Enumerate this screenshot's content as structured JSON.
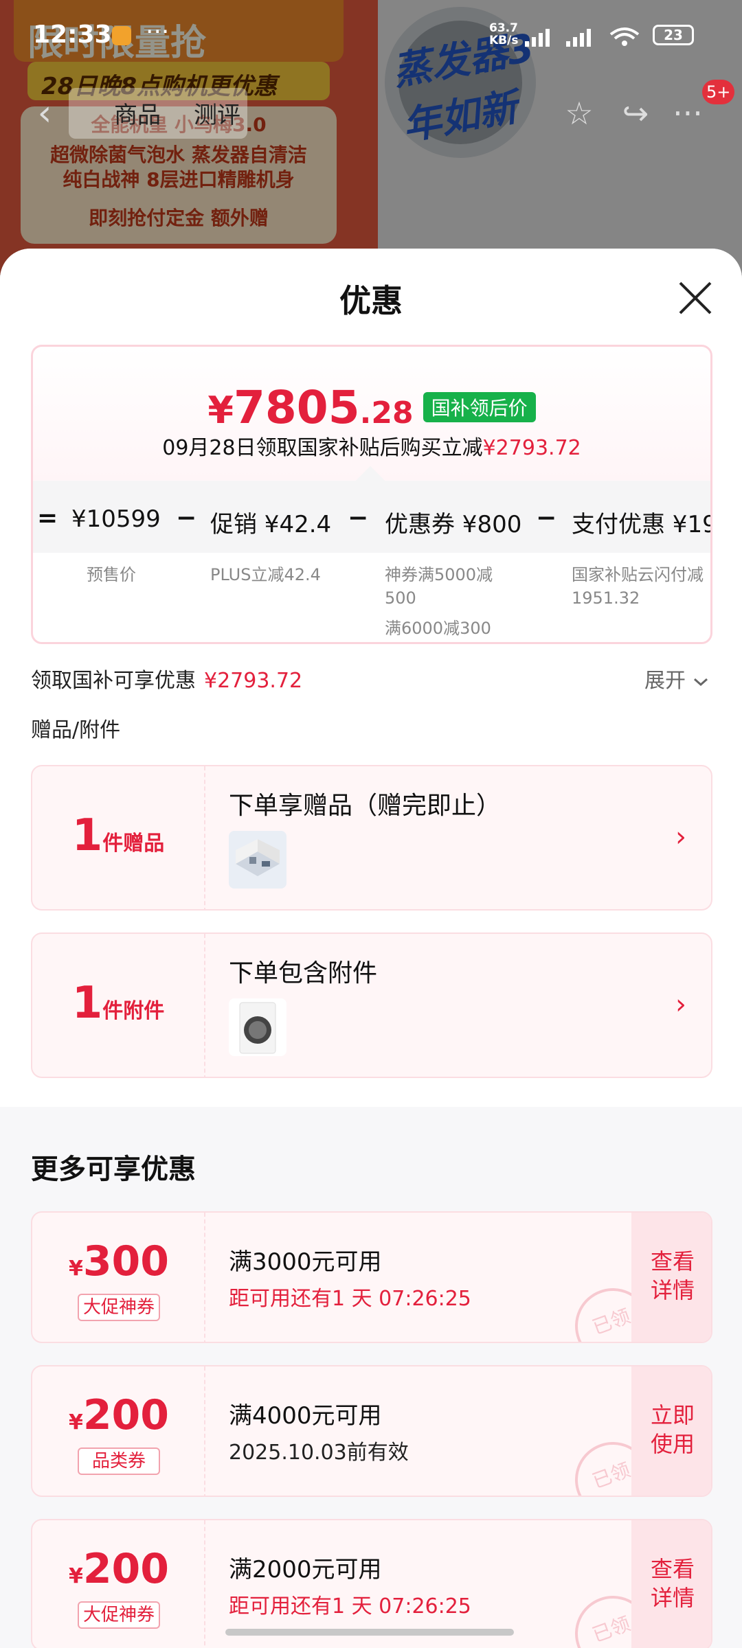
{
  "status_bar": {
    "time": "12:33",
    "net_speed": "63.7",
    "net_unit": "KB/s",
    "battery": "23"
  },
  "background_page": {
    "banner_top": "限时限量抢",
    "banner_date": "28日晚8点购机更优惠",
    "banner_model": "全能机皇 小乌梅3.0",
    "banner_line1": "超微除菌气泡水 蒸发器自清洁",
    "banner_line2": "纯白战神 8层进口精雕机身",
    "banner_line3": "即刻抢付定金 额外赠",
    "badge_text": "蒸发器3年如新",
    "nav_tabs": [
      "商品",
      "测评"
    ],
    "cart_count": "5+"
  },
  "sheet": {
    "title": "优惠",
    "final_price": {
      "yen": "¥",
      "integer": "7805",
      "decimal": ".28",
      "tag": "国补领后价",
      "desc_prefix": "09月28日领取国家补贴后购买立减",
      "desc_amount": "¥2793.72"
    },
    "breakdown": [
      {
        "op": "=",
        "main": "¥10599",
        "sub": [
          "预售价"
        ]
      },
      {
        "op": "−",
        "main": "促销 ¥42.4",
        "sub": [
          "PLUS立减42.4"
        ]
      },
      {
        "op": "−",
        "main": "优惠券 ¥800",
        "sub": [
          "神券满5000减",
          "500",
          "满6000减300"
        ]
      },
      {
        "op": "−",
        "main": "支付优惠 ¥19",
        "sub": [
          "国家补贴云闪付减",
          "1951.32"
        ]
      }
    ],
    "nation_label": "领取国补可享优惠",
    "nation_amount": "¥2793.72",
    "expand_label": "展开",
    "gifts_title": "赠品/附件",
    "gift_cards": [
      {
        "num": "1",
        "unit": "件赠品",
        "title": "下单享赠品（赠完即止）"
      },
      {
        "num": "1",
        "unit": "件附件",
        "title": "下单包含附件"
      }
    ],
    "more_title": "更多可享优惠",
    "coupons": [
      {
        "yen": "¥",
        "amount": "300",
        "tag": "大促神券",
        "condition": "满3000元可用",
        "sub": "距可用还有1 天 07:26:25",
        "action": "查看详情",
        "stamp": "已领"
      },
      {
        "yen": "¥",
        "amount": "200",
        "tag": "品类券",
        "condition": "满4000元可用",
        "sub": "2025.10.03前有效",
        "action": "立即使用",
        "stamp": "已领"
      },
      {
        "yen": "¥",
        "amount": "200",
        "tag": "大促神券",
        "condition": "满2000元可用",
        "sub": "距可用还有1 天 07:26:25",
        "action": "查看详情",
        "stamp": "已领"
      }
    ]
  },
  "colors": {
    "accent_red": "#e3203c",
    "tag_green": "#17b14a"
  }
}
